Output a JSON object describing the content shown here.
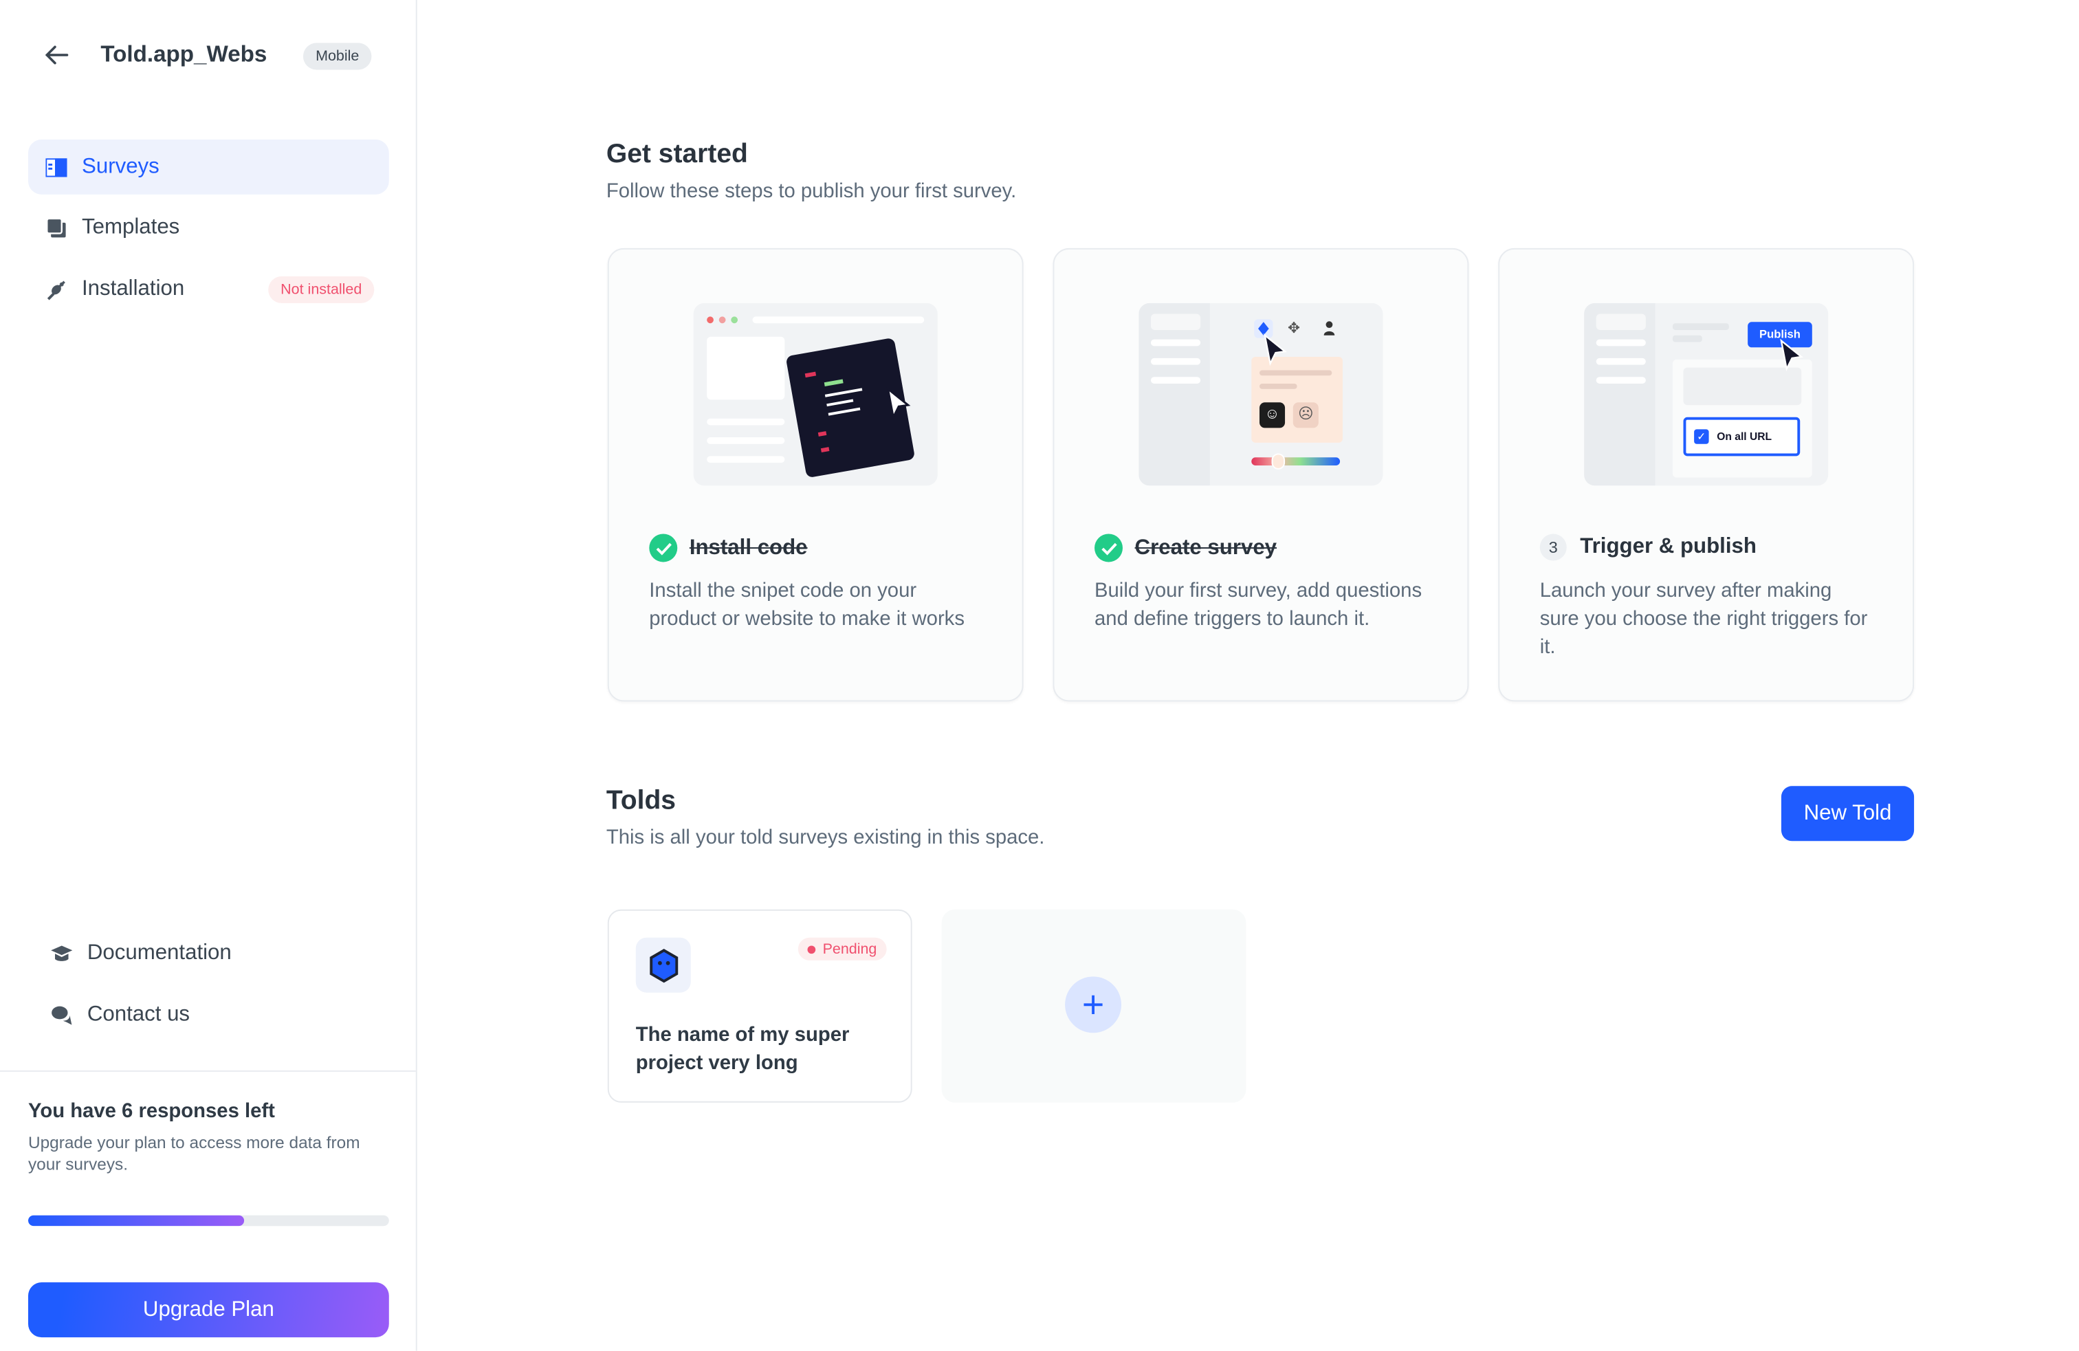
{
  "sidebar": {
    "project_title": "Told.app_Webs",
    "platform_badge": "Mobile",
    "nav": [
      {
        "label": "Surveys",
        "icon": "surveys-icon",
        "active": true
      },
      {
        "label": "Templates",
        "icon": "templates-icon"
      },
      {
        "label": "Installation",
        "icon": "plug-icon",
        "badge": "Not installed"
      }
    ],
    "footer_nav": [
      {
        "label": "Documentation",
        "icon": "graduation-cap-icon"
      },
      {
        "label": "Contact us",
        "icon": "chat-icon"
      }
    ],
    "plan": {
      "title": "You have 6 responses left",
      "description": "Upgrade your plan to access more data from your surveys.",
      "usage_percent": 60,
      "upgrade_label": "Upgrade Plan"
    }
  },
  "get_started": {
    "title": "Get started",
    "subtitle": "Follow these steps to publish your first survey.",
    "steps": [
      {
        "title": "Install code",
        "done": true,
        "description": "Install the snipet code on your product or website to make it works"
      },
      {
        "title": "Create survey",
        "done": true,
        "description": "Build your first survey, add questions and define triggers to launch it."
      },
      {
        "number": "3",
        "title": "Trigger & publish",
        "done": false,
        "description": "Launch your survey after making sure you choose the right triggers for it.",
        "illustration": {
          "publish_label": "Publish",
          "checkbox_label": "On all URL"
        }
      }
    ]
  },
  "tolds": {
    "title": "Tolds",
    "subtitle": "This is all your told surveys existing in this space.",
    "new_button": "New Told",
    "items": [
      {
        "name": "The name of my super project very long",
        "status": "Pending"
      }
    ]
  },
  "colors": {
    "accent": "#1f5cff",
    "success": "#22cc88",
    "danger": "#f0506e",
    "gradient_end": "#9a5cf7"
  }
}
